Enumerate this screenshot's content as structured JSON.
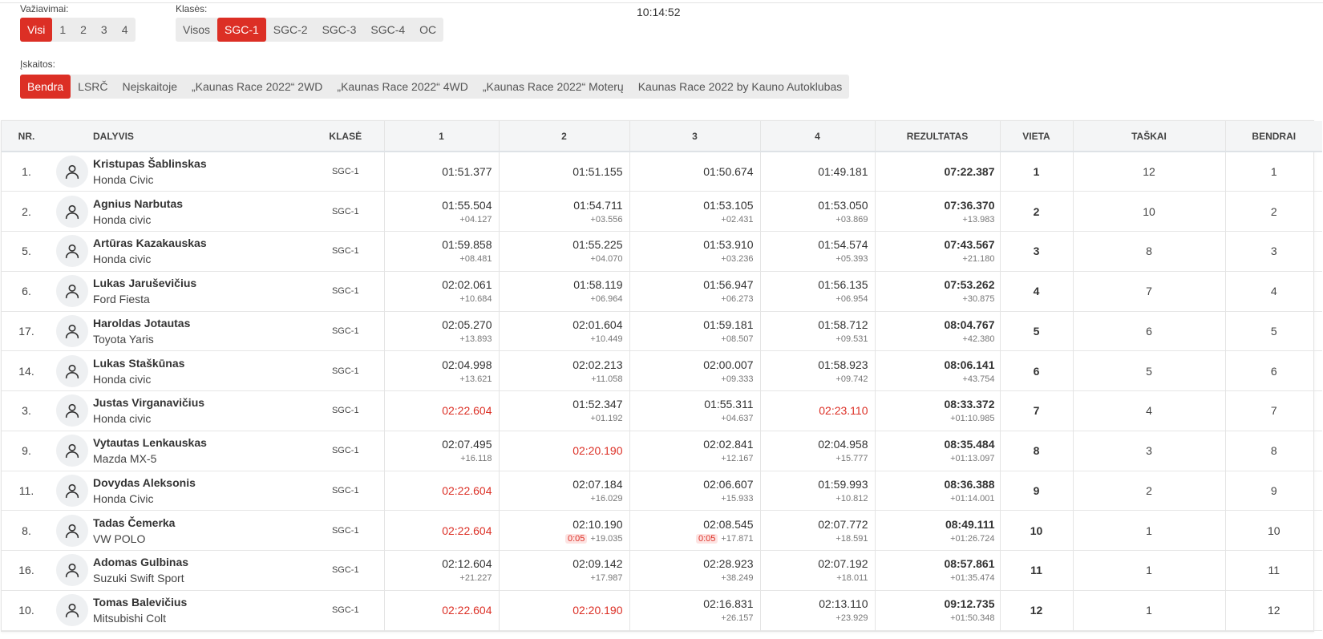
{
  "filters": {
    "runs_label": "Važiavimai:",
    "runs": [
      "Visi",
      "1",
      "2",
      "3",
      "4"
    ],
    "runs_active": "Visi",
    "classes_label": "Klasės:",
    "classes": [
      "Visos",
      "SGC-1",
      "SGC-2",
      "SGC-3",
      "SGC-4",
      "OC"
    ],
    "classes_active": "SGC-1",
    "standings_label": "Įskaitos:",
    "standings": [
      "Bendra",
      "LSRČ",
      "Neįskaitoje",
      "„Kaunas Race 2022“ 2WD",
      "„Kaunas Race 2022“ 4WD",
      "„Kaunas Race 2022“ Moterų",
      "Kaunas Race 2022 by Kauno Autoklubas"
    ],
    "standings_active": "Bendra"
  },
  "clock": "10:14:52",
  "table": {
    "headers": {
      "nr": "NR.",
      "participant": "DALYVIS",
      "class": "KLASĖ",
      "lap1": "1",
      "lap2": "2",
      "lap3": "3",
      "lap4": "4",
      "result": "REZULTATAS",
      "place": "VIETA",
      "points": "TAŠKAI",
      "overall": "BENDRAI"
    },
    "rows": [
      {
        "nr": "1.",
        "name": "Kristupas Šablinskas",
        "car": "Honda Civic",
        "class": "SGC-1",
        "laps": [
          {
            "t": "01:51.377",
            "d": ""
          },
          {
            "t": "01:51.155",
            "d": ""
          },
          {
            "t": "01:50.674",
            "d": ""
          },
          {
            "t": "01:49.181",
            "d": ""
          }
        ],
        "result": "07:22.387",
        "result_diff": "",
        "place": "1",
        "points": "12",
        "overall": "1"
      },
      {
        "nr": "2.",
        "name": "Agnius Narbutas",
        "car": "Honda civic",
        "class": "SGC-1",
        "laps": [
          {
            "t": "01:55.504",
            "d": "+04.127"
          },
          {
            "t": "01:54.711",
            "d": "+03.556"
          },
          {
            "t": "01:53.105",
            "d": "+02.431"
          },
          {
            "t": "01:53.050",
            "d": "+03.869"
          }
        ],
        "result": "07:36.370",
        "result_diff": "+13.983",
        "place": "2",
        "points": "10",
        "overall": "2"
      },
      {
        "nr": "5.",
        "name": "Artūras Kazakauskas",
        "car": "Honda civic",
        "class": "SGC-1",
        "laps": [
          {
            "t": "01:59.858",
            "d": "+08.481"
          },
          {
            "t": "01:55.225",
            "d": "+04.070"
          },
          {
            "t": "01:53.910",
            "d": "+03.236"
          },
          {
            "t": "01:54.574",
            "d": "+05.393"
          }
        ],
        "result": "07:43.567",
        "result_diff": "+21.180",
        "place": "3",
        "points": "8",
        "overall": "3"
      },
      {
        "nr": "6.",
        "name": "Lukas Jaruševičius",
        "car": "Ford Fiesta",
        "class": "SGC-1",
        "laps": [
          {
            "t": "02:02.061",
            "d": "+10.684"
          },
          {
            "t": "01:58.119",
            "d": "+06.964"
          },
          {
            "t": "01:56.947",
            "d": "+06.273"
          },
          {
            "t": "01:56.135",
            "d": "+06.954"
          }
        ],
        "result": "07:53.262",
        "result_diff": "+30.875",
        "place": "4",
        "points": "7",
        "overall": "4"
      },
      {
        "nr": "17.",
        "name": "Haroldas Jotautas",
        "car": "Toyota Yaris",
        "class": "SGC-1",
        "laps": [
          {
            "t": "02:05.270",
            "d": "+13.893"
          },
          {
            "t": "02:01.604",
            "d": "+10.449"
          },
          {
            "t": "01:59.181",
            "d": "+08.507"
          },
          {
            "t": "01:58.712",
            "d": "+09.531"
          }
        ],
        "result": "08:04.767",
        "result_diff": "+42.380",
        "place": "5",
        "points": "6",
        "overall": "5"
      },
      {
        "nr": "14.",
        "name": "Lukas Staškūnas",
        "car": "Honda civic",
        "class": "SGC-1",
        "laps": [
          {
            "t": "02:04.998",
            "d": "+13.621"
          },
          {
            "t": "02:02.213",
            "d": "+11.058"
          },
          {
            "t": "02:00.007",
            "d": "+09.333"
          },
          {
            "t": "01:58.923",
            "d": "+09.742"
          }
        ],
        "result": "08:06.141",
        "result_diff": "+43.754",
        "place": "6",
        "points": "5",
        "overall": "6"
      },
      {
        "nr": "3.",
        "name": "Justas Virganavičius",
        "car": "Honda civic",
        "class": "SGC-1",
        "laps": [
          {
            "t": "02:22.604",
            "d": "",
            "red": true
          },
          {
            "t": "01:52.347",
            "d": "+01.192"
          },
          {
            "t": "01:55.311",
            "d": "+04.637"
          },
          {
            "t": "02:23.110",
            "d": "",
            "red": true
          }
        ],
        "result": "08:33.372",
        "result_diff": "+01:10.985",
        "place": "7",
        "points": "4",
        "overall": "7"
      },
      {
        "nr": "9.",
        "name": "Vytautas Lenkauskas",
        "car": "Mazda MX-5",
        "class": "SGC-1",
        "laps": [
          {
            "t": "02:07.495",
            "d": "+16.118"
          },
          {
            "t": "02:20.190",
            "d": "",
            "red": true
          },
          {
            "t": "02:02.841",
            "d": "+12.167"
          },
          {
            "t": "02:04.958",
            "d": "+15.777"
          }
        ],
        "result": "08:35.484",
        "result_diff": "+01:13.097",
        "place": "8",
        "points": "3",
        "overall": "8"
      },
      {
        "nr": "11.",
        "name": "Dovydas Aleksonis",
        "car": "Honda Civic",
        "class": "SGC-1",
        "laps": [
          {
            "t": "02:22.604",
            "d": "",
            "red": true
          },
          {
            "t": "02:07.184",
            "d": "+16.029"
          },
          {
            "t": "02:06.607",
            "d": "+15.933"
          },
          {
            "t": "01:59.993",
            "d": "+10.812"
          }
        ],
        "result": "08:36.388",
        "result_diff": "+01:14.001",
        "place": "9",
        "points": "2",
        "overall": "9"
      },
      {
        "nr": "8.",
        "name": "Tadas Čemerka",
        "car": "VW POLO",
        "class": "SGC-1",
        "laps": [
          {
            "t": "02:22.604",
            "d": "",
            "red": true
          },
          {
            "t": "02:10.190",
            "d": "+19.035",
            "pen": "0:05"
          },
          {
            "t": "02:08.545",
            "d": "+17.871",
            "pen": "0:05"
          },
          {
            "t": "02:07.772",
            "d": "+18.591"
          }
        ],
        "result": "08:49.111",
        "result_diff": "+01:26.724",
        "place": "10",
        "points": "1",
        "overall": "10"
      },
      {
        "nr": "16.",
        "name": "Adomas Gulbinas",
        "car": "Suzuki Swift Sport",
        "class": "SGC-1",
        "laps": [
          {
            "t": "02:12.604",
            "d": "+21.227"
          },
          {
            "t": "02:09.142",
            "d": "+17.987"
          },
          {
            "t": "02:28.923",
            "d": "+38.249"
          },
          {
            "t": "02:07.192",
            "d": "+18.011"
          }
        ],
        "result": "08:57.861",
        "result_diff": "+01:35.474",
        "place": "11",
        "points": "1",
        "overall": "11"
      },
      {
        "nr": "10.",
        "name": "Tomas Balevičius",
        "car": "Mitsubishi Colt",
        "class": "SGC-1",
        "laps": [
          {
            "t": "02:22.604",
            "d": "",
            "red": true
          },
          {
            "t": "02:20.190",
            "d": "",
            "red": true
          },
          {
            "t": "02:16.831",
            "d": "+26.157"
          },
          {
            "t": "02:13.110",
            "d": "+23.929"
          }
        ],
        "result": "09:12.735",
        "result_diff": "+01:50.348",
        "place": "12",
        "points": "1",
        "overall": "12"
      }
    ]
  },
  "colors": {
    "accent": "#dc2f25",
    "button_bg": "#ececec"
  },
  "icons": {
    "avatar": "user-icon"
  }
}
